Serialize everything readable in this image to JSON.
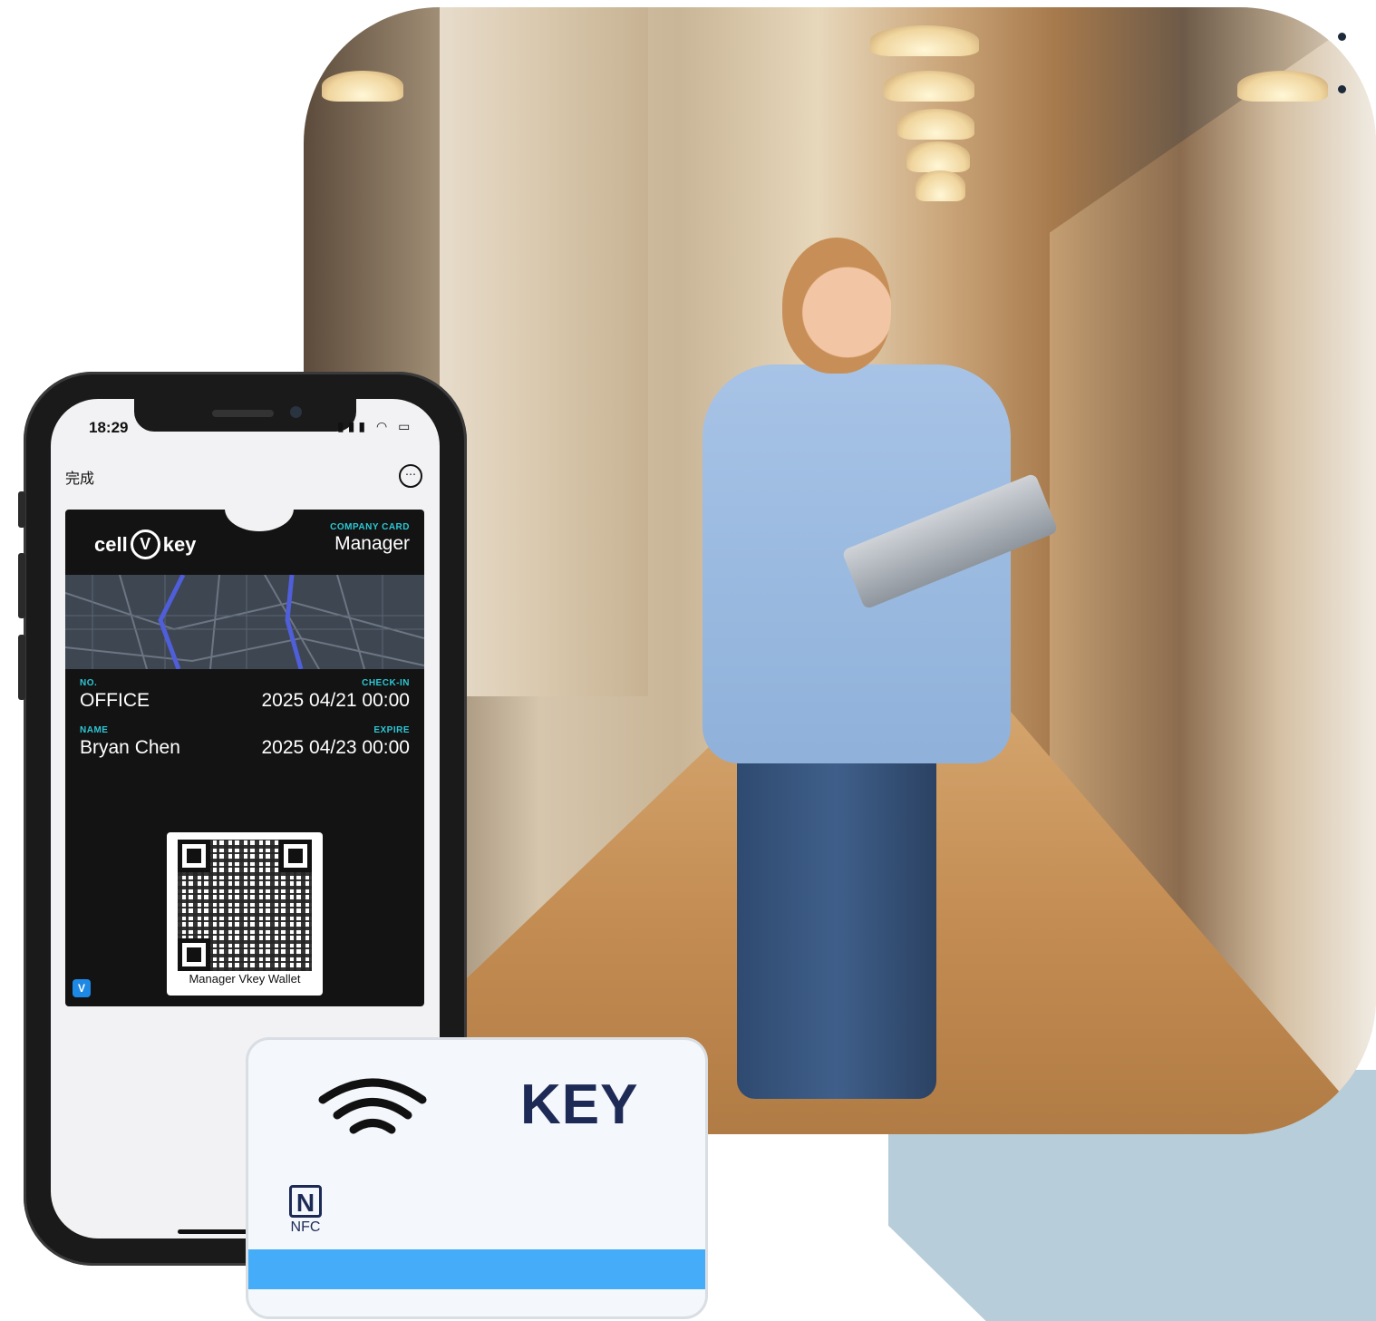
{
  "phone": {
    "status": {
      "time": "18:29",
      "icons": "▮▮▮ ◠ ▭"
    },
    "nav": {
      "done_label": "完成",
      "more_icon": "⋯"
    },
    "pass": {
      "brand_left": "cell",
      "brand_v": "V",
      "brand_right": "key",
      "header_label": "COMPANY CARD",
      "header_value": "Manager",
      "fields": {
        "no_label": "NO.",
        "no_value": "OFFICE",
        "checkin_label": "CHECK-IN",
        "checkin_value": "2025 04/21 00:00",
        "name_label": "NAME",
        "name_value": "Bryan Chen",
        "expire_label": "EXPIRE",
        "expire_value": "2025 04/23 00:00"
      },
      "qr_caption": "Manager Vkey Wallet",
      "mini_logo": "V"
    }
  },
  "card": {
    "title": "KEY",
    "nfc_mark": "N",
    "nfc_label": "NFC",
    "stripe_color": "#44acf8",
    "text_color": "#1d2a56"
  },
  "colors": {
    "accent": "#2cc7d4",
    "background_shape": "#b7cdd9"
  }
}
